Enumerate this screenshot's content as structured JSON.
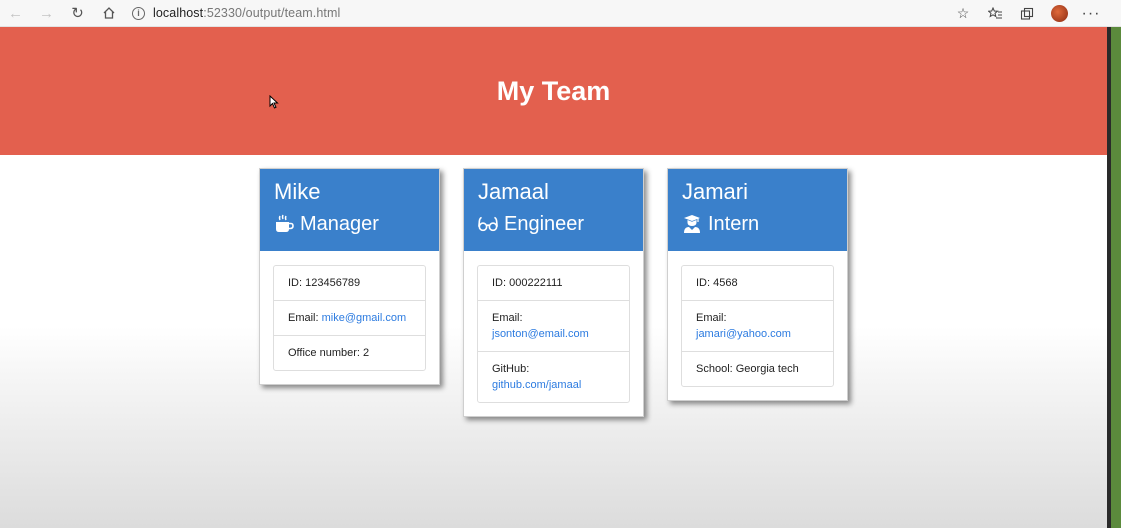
{
  "browser": {
    "url_host": "localhost",
    "url_rest": ":52330/output/team.html",
    "icons": [
      "back-icon",
      "forward-icon",
      "refresh-icon",
      "home-icon",
      "info-icon",
      "star-icon",
      "favorites-icon",
      "collections-icon",
      "profile-avatar",
      "more-icon"
    ]
  },
  "header": {
    "title": "My Team"
  },
  "colors": {
    "header_bg": "#e3604e",
    "card_head_bg": "#3a80cb",
    "link": "#2c7be0"
  },
  "cards": [
    {
      "name": "Mike",
      "role": "Manager",
      "role_icon": "coffee-mug-icon",
      "id_text": "ID: 123456789",
      "email_label": "Email:",
      "email": "mike@gmail.com",
      "extra_text": "Office number: 2"
    },
    {
      "name": "Jamaal",
      "role": "Engineer",
      "role_icon": "glasses-icon",
      "id_text": "ID: 000222111",
      "email_label": "Email:",
      "email": "jsonton@email.com",
      "extra_label": "GitHub:",
      "extra_link": "github.com/jamaal"
    },
    {
      "name": "Jamari",
      "role": "Intern",
      "role_icon": "graduate-icon",
      "id_text": "ID: 4568",
      "email_label": "Email:",
      "email": "jamari@yahoo.com",
      "extra_text": "School: Georgia tech"
    }
  ]
}
